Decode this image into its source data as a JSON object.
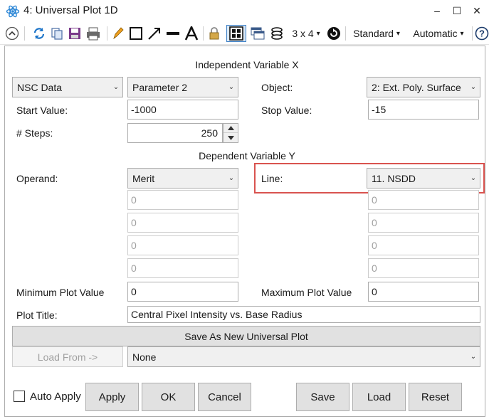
{
  "window": {
    "title": "4: Universal Plot 1D",
    "minimize_glyph": "–",
    "maximize_glyph": "☐",
    "close_glyph": "✕"
  },
  "toolbar": {
    "layout_label": "3 x 4",
    "standard_label": "Standard",
    "automatic_label": "Automatic",
    "dropdown_glyph": "▾"
  },
  "independent": {
    "heading": "Independent Variable X",
    "source_type": "NSC Data",
    "parameter": "Parameter 2",
    "object_label": "Object:",
    "object_value": "2: Ext. Poly. Surface",
    "start_label": "Start Value:",
    "start_value": "-1000",
    "stop_label": "Stop Value:",
    "stop_value": "-15",
    "steps_label": "# Steps:",
    "steps_value": "250"
  },
  "dependent": {
    "heading": "Dependent Variable Y",
    "operand_label": "Operand:",
    "operand_value": "Merit",
    "line_label": "Line:",
    "line_value": "11. NSDD",
    "left_params": [
      "0",
      "0",
      "0",
      "0"
    ],
    "right_params": [
      "0",
      "0",
      "0",
      "0"
    ]
  },
  "plot": {
    "min_label": "Minimum Plot Value",
    "min_value": "0",
    "max_label": "Maximum Plot Value",
    "max_value": "0",
    "title_label": "Plot Title:",
    "title_value": "Central Pixel Intensity vs. Base Radius"
  },
  "actions": {
    "save_new": "Save As New Universal Plot",
    "load_from": "Load From ->",
    "load_select": "None",
    "auto_apply": "Auto Apply",
    "apply": "Apply",
    "ok": "OK",
    "cancel": "Cancel",
    "save": "Save",
    "load": "Load",
    "reset": "Reset"
  },
  "colors": {
    "highlight": "#d9534f",
    "accent_blue": "#1a73c8"
  }
}
